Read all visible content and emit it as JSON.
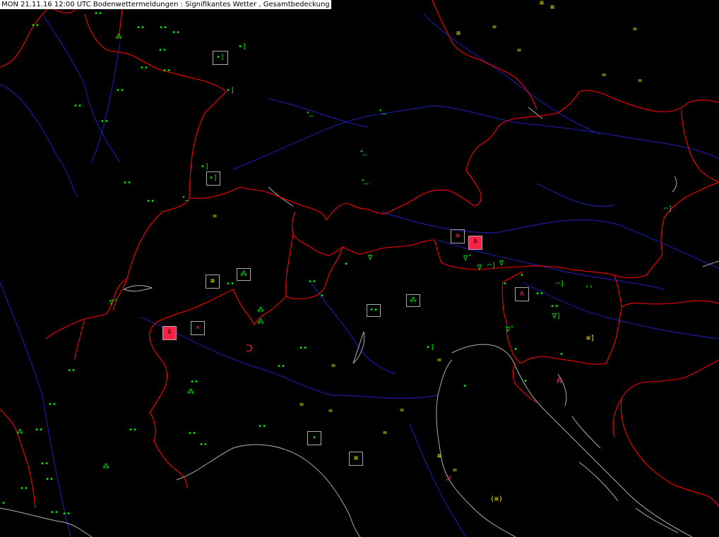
{
  "header": {
    "title": "MON 21.11.16 12:00 UTC  Bodenwettermeldungen :  Signifikantes Wetter , Gesamtbedeckung"
  },
  "colors": {
    "background": "#000000",
    "borders": "#ff0000",
    "rivers": "#1a1aa0",
    "coast": "#b0b0b0",
    "rain": "#00ee00",
    "fog": "#ffee00",
    "severe": "#ff2244"
  },
  "legend_icons": {
    "rain": "rain-drizzle-icon",
    "fog": "fog-icon",
    "thunder": "thunderstorm-icon",
    "showers": "shower-icon",
    "snow": "snow-icon"
  }
}
